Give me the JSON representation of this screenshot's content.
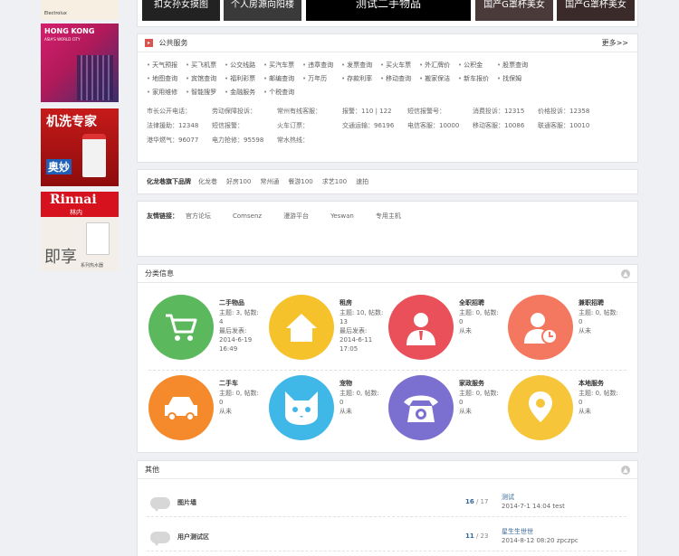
{
  "top_strip": {
    "items": [
      "扣女孙女摸图",
      "个人房源向阳楼",
      "测试二手物品",
      "国产G罩杯美女",
      "国产G罩杯美女"
    ]
  },
  "left_ads": {
    "ad1_brand": "Electrolux",
    "ad2_line1": "HONG KONG",
    "ad2_line2": "ASIA'S WORLD CITY",
    "ad3_title": "机洗专家",
    "ad3_brand": "奥妙",
    "ad4_brand": "Rinnai",
    "ad4_cn": "林内",
    "ad4_big": "即享",
    "ad4_sub": "系列热水器"
  },
  "public_service": {
    "title": "公共服务",
    "more": "更多>>",
    "rows": [
      [
        "天气预报",
        "买飞机票",
        "公交线路",
        "买汽车票",
        "违章查询",
        "发票查询",
        "买火车票",
        "外汇牌价",
        "公积金",
        "股票查询"
      ],
      [
        "地图查询",
        "宾馆查询",
        "福利彩票",
        "邮编查询",
        "万年历",
        "存款利率",
        "移动查询",
        "搬家保洁",
        "新车报价",
        "找保姆"
      ],
      [
        "家用维修",
        "智能搜罗",
        "金融服务",
        "个税查询"
      ]
    ],
    "phones": [
      [
        "市长公开电话：",
        "劳动保障投诉：",
        "常州有线客服：",
        "报警：110 | 122",
        "短信报警号：",
        "消费投诉：12315",
        "价格投诉：12358"
      ],
      [
        "法律援助：12348",
        "短信报警：",
        "火车订票：",
        "交通运输：96196",
        "电信客服：10000",
        "移动客服：10086",
        "联通客服：10010"
      ],
      [
        "港华燃气：96077",
        "电力抢修：95598",
        "常水热线："
      ]
    ]
  },
  "sub_products": {
    "label": "化龙巷旗下品牌",
    "links": [
      "化龙巷",
      "好房100",
      "常州通",
      "餐游100",
      "求艺100",
      "速拍"
    ]
  },
  "friend_links": {
    "label": "友情链接：",
    "links": [
      "官方论坛",
      "Comsenz",
      "漫游平台",
      "Yeswan",
      "专用主机"
    ]
  },
  "categories": {
    "title": "分类信息",
    "items": [
      {
        "name": "二手物品",
        "l1": "主题: 3, 帖数:",
        "l2": "4",
        "l3": "最后发表:",
        "l4": "2014-6-19",
        "l5": "16:49",
        "color": "#5cb85c",
        "icon": "cart-icon"
      },
      {
        "name": "租房",
        "l1": "主题: 10, 帖数:",
        "l2": "13",
        "l3": "最后发表:",
        "l4": "2014-6-11",
        "l5": "17:05",
        "color": "#f5c22b",
        "icon": "house-icon"
      },
      {
        "name": "全职招聘",
        "l1": "主题: 0, 帖数:",
        "l2": "0",
        "l3": "从未",
        "l4": "",
        "l5": "",
        "color": "#e9505a",
        "icon": "person-suit-icon"
      },
      {
        "name": "兼职招聘",
        "l1": "主题: 0, 帖数:",
        "l2": "0",
        "l3": "从未",
        "l4": "",
        "l5": "",
        "color": "#f4785f",
        "icon": "person-clock-icon"
      },
      {
        "name": "二手车",
        "l1": "主题: 0, 帖数:",
        "l2": "0",
        "l3": "从未",
        "l4": "",
        "l5": "",
        "color": "#f48a2c",
        "icon": "car-icon"
      },
      {
        "name": "宠物",
        "l1": "主题: 0, 帖数:",
        "l2": "0",
        "l3": "从未",
        "l4": "",
        "l5": "",
        "color": "#3fb8e8",
        "icon": "cat-icon"
      },
      {
        "name": "家政服务",
        "l1": "主题: 0, 帖数:",
        "l2": "0",
        "l3": "从未",
        "l4": "",
        "l5": "",
        "color": "#7b6fcf",
        "icon": "phone-icon"
      },
      {
        "name": "本地服务",
        "l1": "主题: 0, 帖数:",
        "l2": "0",
        "l3": "从未",
        "l4": "",
        "l5": "",
        "color": "#f7c53a",
        "icon": "location-pin-icon"
      }
    ]
  },
  "others": {
    "title": "其他",
    "rows": [
      {
        "name": "图片墙",
        "count_a": "16",
        "count_b": " / 17",
        "latest": "测试",
        "meta": "2014-7-1 14:04 test"
      },
      {
        "name": "用户测试区",
        "count_a": "11",
        "count_b": " / 23",
        "latest": "星生生世世",
        "meta": "2014-8-12 08:20 zpczpc"
      }
    ]
  }
}
